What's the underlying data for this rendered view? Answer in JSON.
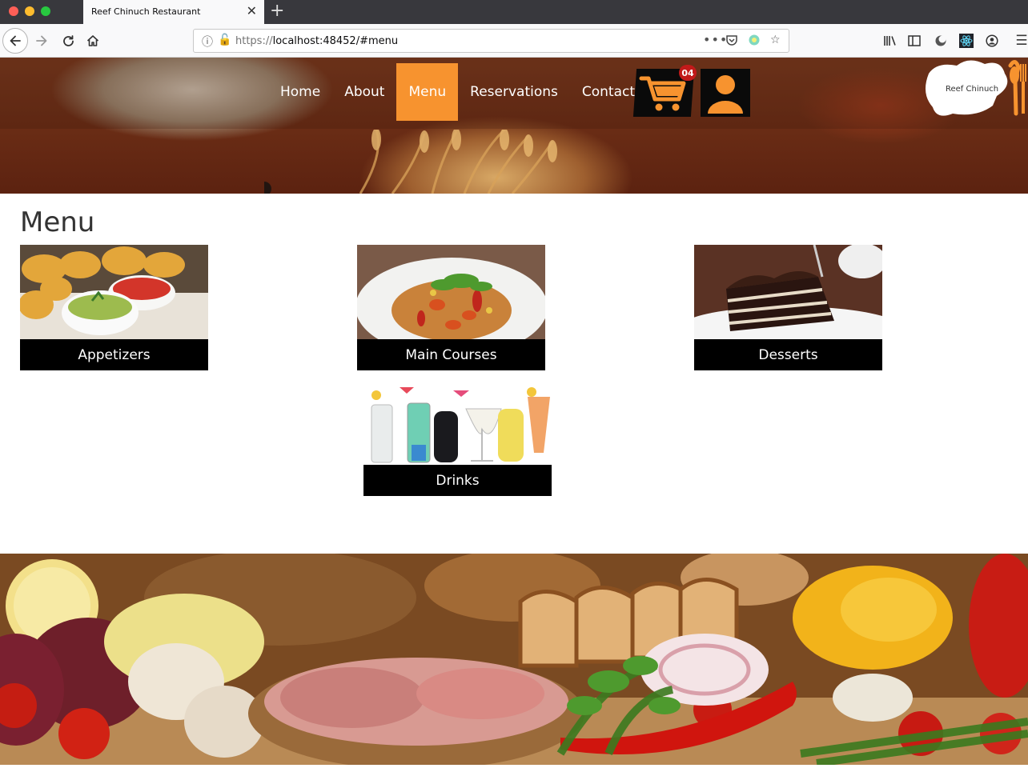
{
  "browser": {
    "tab_title": "Reef Chinuch Restaurant",
    "url_scheme": "https://",
    "url_rest": "localhost:48452/#menu"
  },
  "nav": {
    "items": [
      {
        "label": "Home",
        "active": false
      },
      {
        "label": "About",
        "active": false
      },
      {
        "label": "Menu",
        "active": true
      },
      {
        "label": "Reservations",
        "active": false
      },
      {
        "label": "Contact",
        "active": false
      }
    ],
    "cart_count": "04"
  },
  "logo": {
    "text": "Reef Chinuch"
  },
  "colors": {
    "accent": "#f7932f",
    "badge": "#c21a1a",
    "tile_bar": "#000000"
  },
  "page": {
    "title": "Menu",
    "categories": [
      {
        "label": "Appetizers"
      },
      {
        "label": "Main Courses"
      },
      {
        "label": "Desserts"
      },
      {
        "label": "Drinks"
      }
    ]
  }
}
